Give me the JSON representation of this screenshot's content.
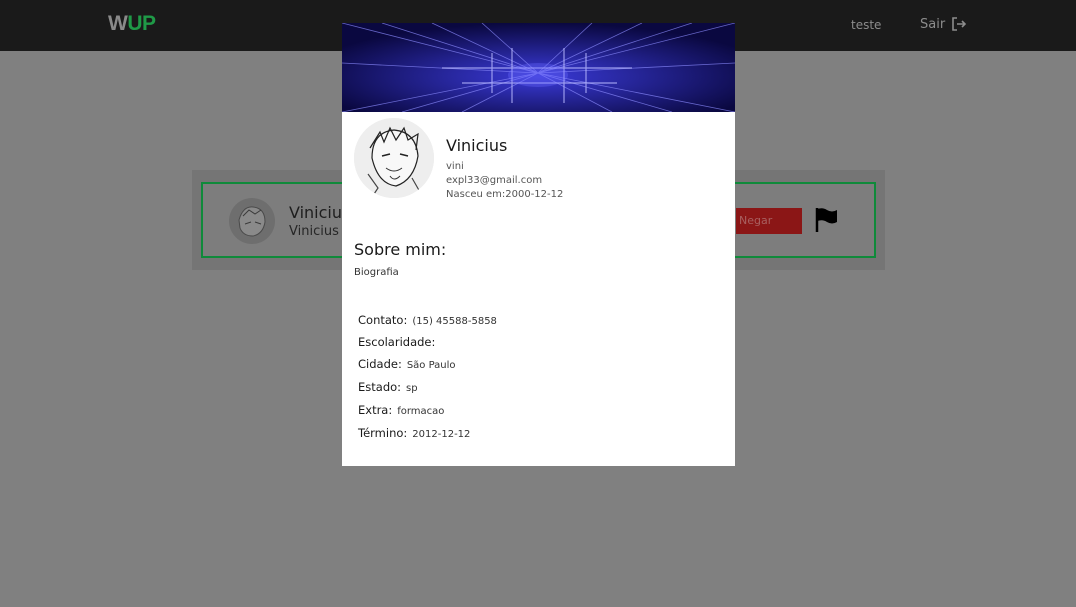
{
  "nav": {
    "logo_w": "W",
    "logo_up": "UP",
    "username": "teste",
    "logout_label": "Sair"
  },
  "background_card": {
    "name": "Vinicius",
    "subtitle": "Vinicius",
    "deny_label": "Negar"
  },
  "profile": {
    "name": "Vinicius",
    "username": "vini",
    "email": "expl33@gmail.com",
    "birth": "Nasceu em:2000-12-12",
    "about_title": "Sobre mim:",
    "about_text": "Biografia"
  },
  "details": [
    {
      "label": "Contato:",
      "value": "(15) 45588-5858"
    },
    {
      "label": "Escolaridade:",
      "value": ""
    },
    {
      "label": "Cidade:",
      "value": "São Paulo"
    },
    {
      "label": "Estado:",
      "value": "sp"
    },
    {
      "label": "Extra:",
      "value": "formacao"
    },
    {
      "label": "Término:",
      "value": "2012-12-12"
    }
  ],
  "colors": {
    "brand_green": "#1f9a47",
    "deny_red": "#e02424",
    "banner_blue": "#12105a"
  }
}
